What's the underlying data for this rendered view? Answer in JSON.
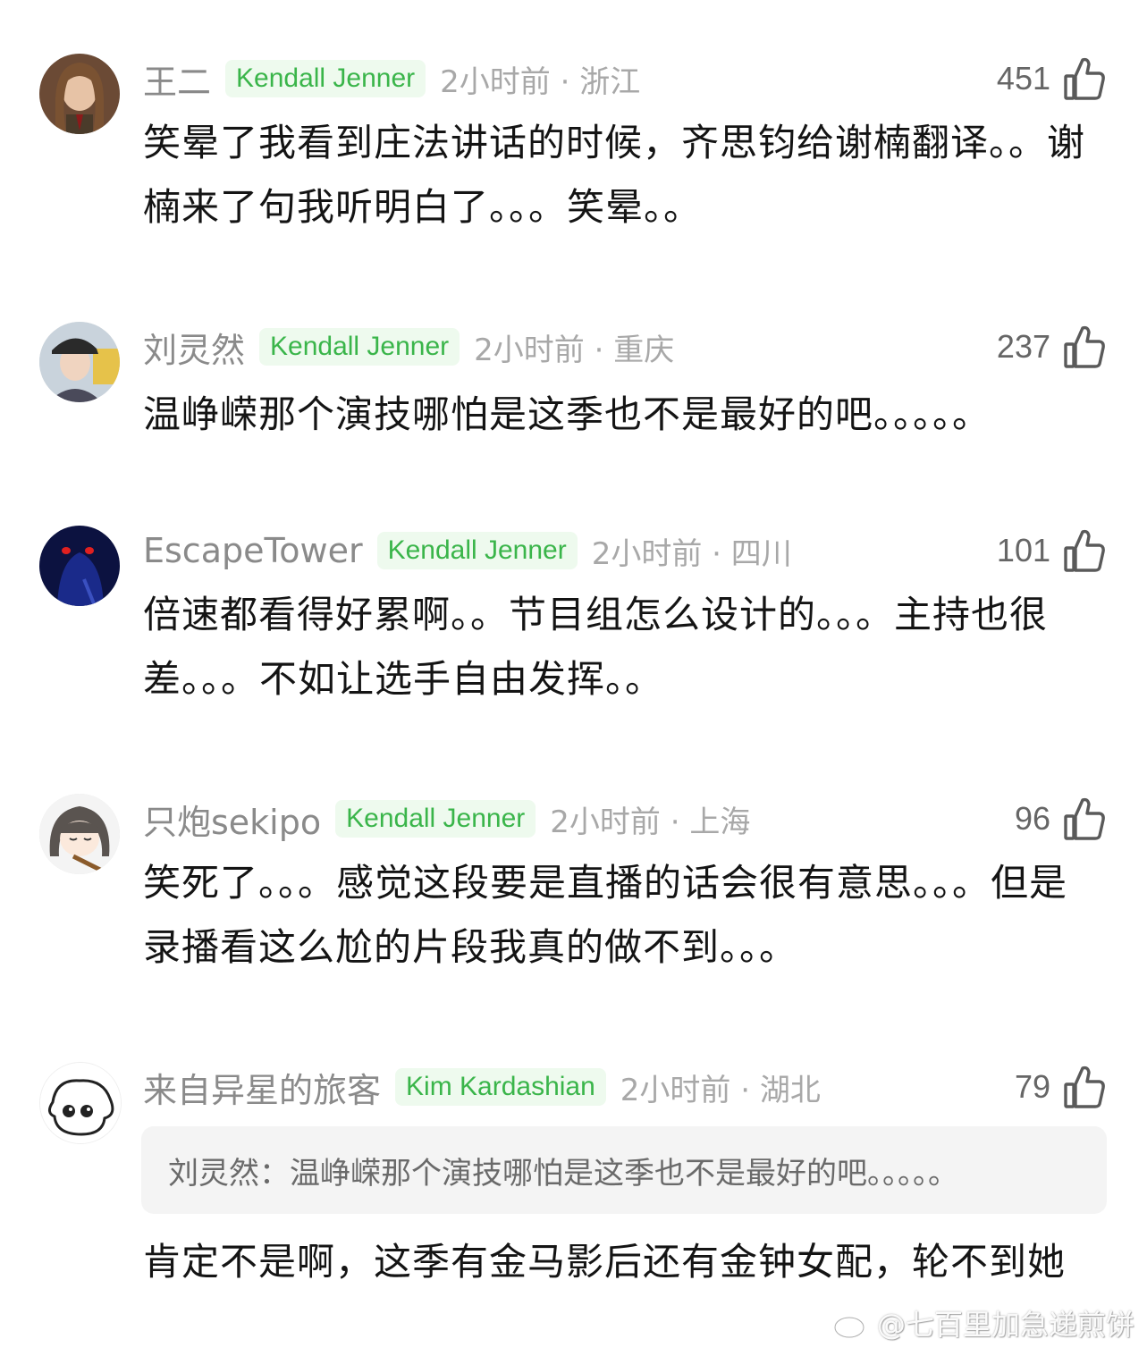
{
  "colors": {
    "username": "#8a8a8a",
    "badge_text": "#3ab54a",
    "badge_bg": "#eefaee",
    "meta": "#a8a8a8",
    "quote_bg": "#f4f4f4"
  },
  "comments": [
    {
      "username": "王二",
      "badge": "Kendall Jenner",
      "time_location": "2小时前 · 浙江",
      "likes": "451",
      "text": "笑晕了我看到庄法讲话的时候，齐思钧给谢楠翻译。。谢楠来了句我听明白了。。。笑晕。。"
    },
    {
      "username": "刘灵然",
      "badge": "Kendall Jenner",
      "time_location": "2小时前 · 重庆",
      "likes": "237",
      "text": "温峥嵘那个演技哪怕是这季也不是最好的吧。。。。。"
    },
    {
      "username": "EscapeTower",
      "badge": "Kendall Jenner",
      "time_location": "2小时前 · 四川",
      "likes": "101",
      "text": "倍速都看得好累啊。。节目组怎么设计的。。。主持也很差。。。不如让选手自由发挥。。"
    },
    {
      "username": "只炮sekipo",
      "badge": "Kendall Jenner",
      "time_location": "2小时前 · 上海",
      "likes": "96",
      "text": "笑死了。。。感觉这段要是直播的话会很有意思。。。但是录播看这么尬的片段我真的做不到。。。"
    },
    {
      "username": "来自异星的旅客",
      "badge": "Kim Kardashian",
      "time_location": "2小时前 · 湖北",
      "likes": "79",
      "quote": "刘灵然：温峥嵘那个演技哪怕是这季也不是最好的吧。。。。。",
      "text": "肯定不是啊，这季有金马影后还有金钟女配，轮不到她"
    }
  ],
  "watermark": "@七百里加急递煎饼",
  "icons": {
    "like": "thumbs-up-icon",
    "watermark": "weibo-logo-icon"
  }
}
